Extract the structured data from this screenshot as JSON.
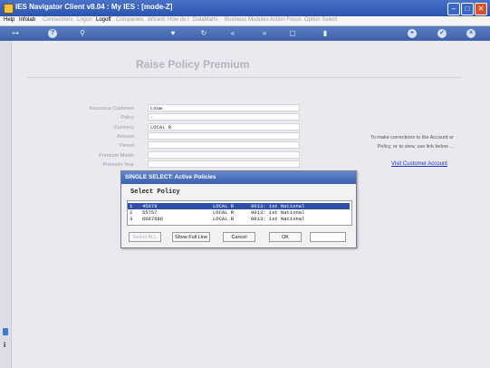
{
  "window": {
    "title": "IES Navigator Client v8.04 : My IES :      [mode-Z]",
    "controls": {
      "minimize": "–",
      "maximize": "□",
      "close": "✕"
    }
  },
  "menu": [
    {
      "label": "Help",
      "enabled": true
    },
    {
      "label": "Infolab",
      "enabled": true
    },
    {
      "label": "Connections",
      "enabled": false
    },
    {
      "label": "Logon",
      "enabled": false
    },
    {
      "label": "Logoff",
      "enabled": true
    },
    {
      "label": "Companies",
      "enabled": false
    },
    {
      "label": "Wizard",
      "enabled": false
    },
    {
      "label": "How do I",
      "enabled": false
    },
    {
      "label": "DataMarts",
      "enabled": false
    },
    {
      "label": "Business Modules",
      "enabled": false
    },
    {
      "label": "Action Focus",
      "enabled": false
    },
    {
      "label": "Option Select",
      "enabled": false
    }
  ],
  "toolbar_icons": [
    "key-icon",
    "help-icon",
    "search-icon",
    "heart-icon",
    "refresh-icon",
    "rewind-icon",
    "fast-forward-icon",
    "copy-icon",
    "save-icon",
    "add-icon",
    "check-icon",
    "cancel-icon"
  ],
  "page": {
    "heading": "Raise Policy Premium",
    "fields": [
      {
        "label": "Insurance Customer",
        "value": "Louw"
      },
      {
        "label": "Policy",
        "value": "-"
      },
      {
        "label": "Currency",
        "value": "LOCAL R"
      },
      {
        "label": "Amount",
        "value": ""
      },
      {
        "label": "Period",
        "value": ""
      },
      {
        "label": "Premium Month",
        "value": ""
      },
      {
        "label": "Premium Year",
        "value": ""
      }
    ],
    "hint_line1": "To make corrections to the Account or",
    "hint_line2": "Policy, or to view, use link below ...",
    "link": "Visit Customer Account"
  },
  "dialog": {
    "title": "SINGLE SELECT: Active Policies",
    "subtitle": "Select Policy",
    "rows": [
      {
        "n": "1",
        "policy": "45678",
        "currency": "LOCAL R",
        "branch": "0013: 1st National",
        "selected": true
      },
      {
        "n": "2",
        "policy": "55757",
        "currency": "LOCAL R",
        "branch": "0013: 1st National",
        "selected": false
      },
      {
        "n": "3",
        "policy": "6687686",
        "currency": "LOCAL R",
        "branch": "0013: 1st National",
        "selected": false
      }
    ],
    "buttons": {
      "select_all": "Select ALL",
      "show_full_line": "Show Full Line",
      "cancel": "Cancel",
      "ok": "OK"
    }
  },
  "colors": {
    "titlebar": "#2a54b0",
    "selection": "#2f4ea8",
    "link": "#2030c0"
  }
}
